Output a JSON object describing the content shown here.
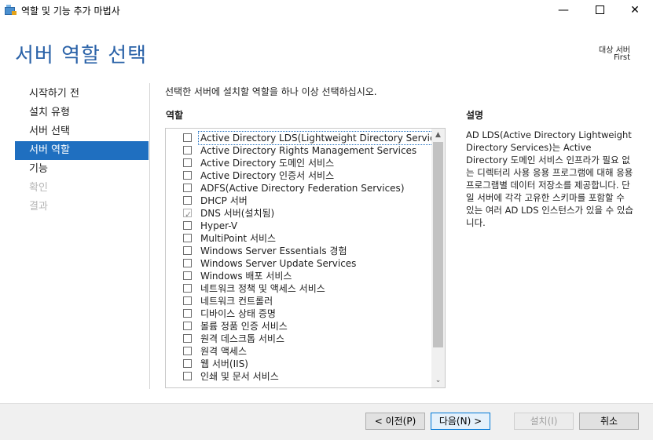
{
  "window": {
    "title": "역할 및 기능 추가 마법사",
    "min_glyph": "—",
    "close_glyph": "✕"
  },
  "page": {
    "title": "서버 역할 선택",
    "destination_label": "대상 서버",
    "destination_name": "First"
  },
  "nav": {
    "items": [
      {
        "label": "시작하기 전",
        "state": "normal"
      },
      {
        "label": "설치 유형",
        "state": "normal"
      },
      {
        "label": "서버 선택",
        "state": "normal"
      },
      {
        "label": "서버 역할",
        "state": "active"
      },
      {
        "label": "기능",
        "state": "normal"
      },
      {
        "label": "확인",
        "state": "disabled"
      },
      {
        "label": "결과",
        "state": "disabled"
      }
    ]
  },
  "main": {
    "instruction": "선택한 서버에 설치할 역할을 하나 이상 선택하십시오.",
    "roles_header": "역할",
    "roles": [
      {
        "label": "Active Directory LDS(Lightweight Directory Services)",
        "checked": false,
        "selected": true
      },
      {
        "label": "Active Directory Rights Management Services",
        "checked": false
      },
      {
        "label": "Active Directory 도메인 서비스",
        "checked": false
      },
      {
        "label": "Active Directory 인증서 서비스",
        "checked": false
      },
      {
        "label": "ADFS(Active Directory Federation Services)",
        "checked": false
      },
      {
        "label": "DHCP 서버",
        "checked": false
      },
      {
        "label": "DNS 서버(설치됨)",
        "checked": true
      },
      {
        "label": "Hyper-V",
        "checked": false
      },
      {
        "label": "MultiPoint 서비스",
        "checked": false
      },
      {
        "label": "Windows Server Essentials 경험",
        "checked": false
      },
      {
        "label": "Windows Server Update Services",
        "checked": false
      },
      {
        "label": "Windows 배포 서비스",
        "checked": false
      },
      {
        "label": "네트워크 정책 및 액세스 서비스",
        "checked": false
      },
      {
        "label": "네트워크 컨트롤러",
        "checked": false
      },
      {
        "label": "디바이스 상태 증명",
        "checked": false
      },
      {
        "label": "볼륨 정품 인증 서비스",
        "checked": false
      },
      {
        "label": "원격 데스크톱 서비스",
        "checked": false
      },
      {
        "label": "원격 액세스",
        "checked": false
      },
      {
        "label": "웹 서버(IIS)",
        "checked": false
      },
      {
        "label": "인쇄 및 문서 서비스",
        "checked": false
      }
    ],
    "check_glyph": "✓",
    "scroll_up_glyph": "▲",
    "scroll_down_glyph": "⌄",
    "description_header": "설명",
    "description": "AD LDS(Active Directory Lightweight Directory Services)는 Active Directory 도메인 서비스 인프라가 필요 없는 디렉터리 사용 응용 프로그램에 대해 응용 프로그램별 데이터 저장소를 제공합니다. 단일 서버에 각각 고유한 스키마를 포함할 수 있는 여러 AD LDS 인스턴스가 있을 수 있습니다."
  },
  "footer": {
    "prev_label": "< 이전(P)",
    "next_label": "다음(N) >",
    "install_label": "설치(I)",
    "cancel_label": "취소"
  }
}
